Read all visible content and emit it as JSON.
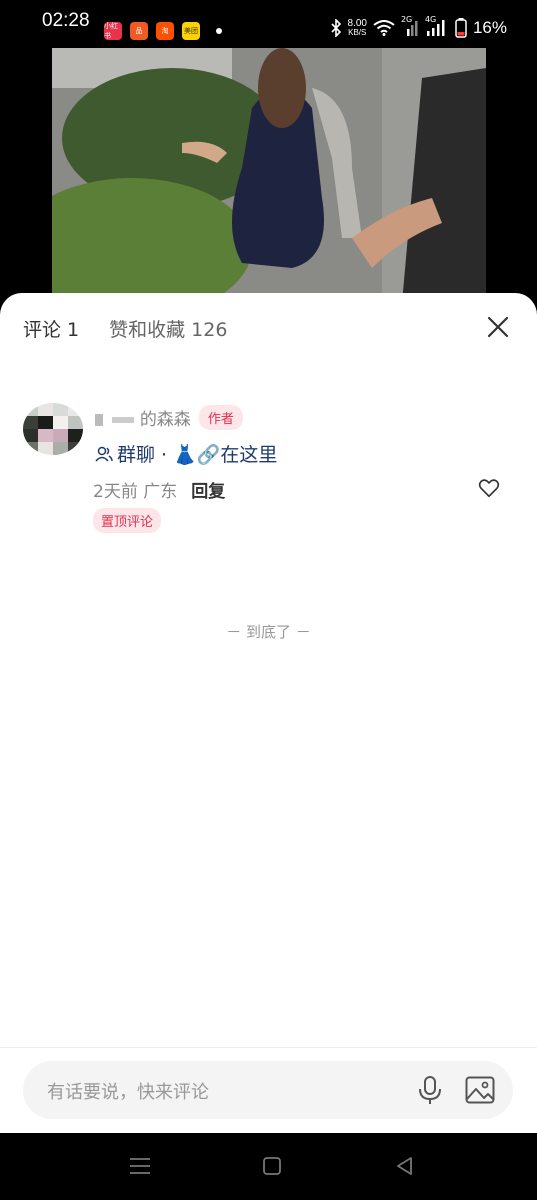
{
  "status_bar": {
    "time": "02:28",
    "app_icons": [
      {
        "label": "小红书",
        "color": "#e8334a"
      },
      {
        "label": "品",
        "color": "#f05a24"
      },
      {
        "label": "淘",
        "color": "#ff5000"
      },
      {
        "label": "美团",
        "color": "#ffd100"
      }
    ],
    "net_speed_value": "8.00",
    "net_speed_unit": "KB/S",
    "signal_1": "2G",
    "signal_2": "4G",
    "battery": "16%"
  },
  "sheet": {
    "tabs": [
      {
        "label": "评论 1"
      },
      {
        "label": "赞和收藏 126"
      }
    ]
  },
  "comment": {
    "author_name": "的森森",
    "author_badge": "作者",
    "text": "群聊 · 👗🔗在这里",
    "time": "2天前",
    "location": "广东",
    "reply_label": "回复",
    "pinned_label": "置顶评论"
  },
  "end_text": "－ 到底了 －",
  "input": {
    "placeholder": "有话要说，快来评论"
  },
  "colors": {
    "accent": "#e0304e",
    "link": "#1f3b6e"
  }
}
